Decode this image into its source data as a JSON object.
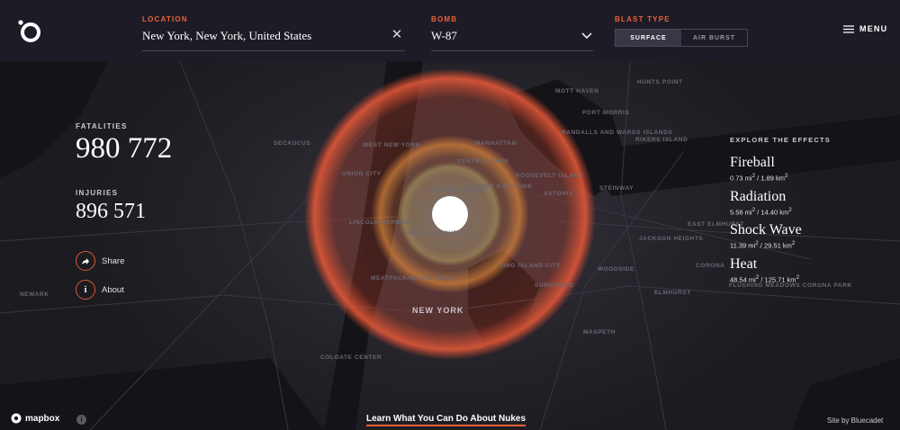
{
  "header": {
    "location_label": "LOCATION",
    "location_value": "New York, New York, United States",
    "bomb_label": "BOMB",
    "bomb_value": "W-87",
    "blast_label": "BLAST TYPE",
    "blast_options": [
      "SURFACE",
      "AIR BURST"
    ],
    "blast_selected": "SURFACE",
    "menu_label": "MENU"
  },
  "stats": {
    "fatalities_label": "FATALITIES",
    "fatalities_value": "980 772",
    "injuries_label": "INJURIES",
    "injuries_value": "896 571"
  },
  "actions": {
    "share_label": "Share",
    "about_label": "About"
  },
  "effects": {
    "title": "EXPLORE THE EFFECTS",
    "items": [
      {
        "name": "Fireball",
        "area_mi": "0.73 mi",
        "area_km": "1.89 km"
      },
      {
        "name": "Radiation",
        "area_mi": "5.56 mi",
        "area_km": "14.40 km"
      },
      {
        "name": "Shock Wave",
        "area_mi": "11.39 mi",
        "area_km": "29.51 km"
      },
      {
        "name": "Heat",
        "area_mi": "48.54 mi",
        "area_km": "125.71 km"
      }
    ]
  },
  "map": {
    "labels": [
      "NEW YORK",
      "MANHATTAN",
      "SECAUCUS",
      "WEST NEW YORK",
      "UNION CITY",
      "CENTRAL PARK",
      "LINCOLN SQUARE",
      "UPPER EAST SIDE",
      "LINCOLN HARBOR",
      "HELL'S KITCHEN",
      "MEATPACKING DISTRICT",
      "LONG ISLAND CITY",
      "ASTORIA",
      "STEINWAY",
      "JACKSON HEIGHTS",
      "WOODSIDE",
      "EAST ELMHURST",
      "CORONA",
      "ELMHURST",
      "MASPETH",
      "SUNNYSIDE",
      "PORT MORRIS",
      "RIKERS ISLAND",
      "MOTT HAVEN",
      "HUNTS POINT",
      "RANDALLS AND WARDS ISLANDS",
      "ROOSEVELT ISLAND",
      "NEWARK",
      "COLGATE CENTER",
      "FLUSHING MEADOWS CORONA PARK"
    ]
  },
  "footer": {
    "mapbox_label": "mapbox",
    "learn_link": "Learn What You Can Do About Nukes",
    "credit": "Site by Bluecadet"
  },
  "colors": {
    "accent": "#e8623a",
    "topbar": "#1e1b26",
    "map_bg": "#1c1b20",
    "heat_ring": "#d84a30",
    "shock_ring": "#c88a4a",
    "radiation_ring": "#b0a070",
    "fireball": "#ffffff"
  }
}
